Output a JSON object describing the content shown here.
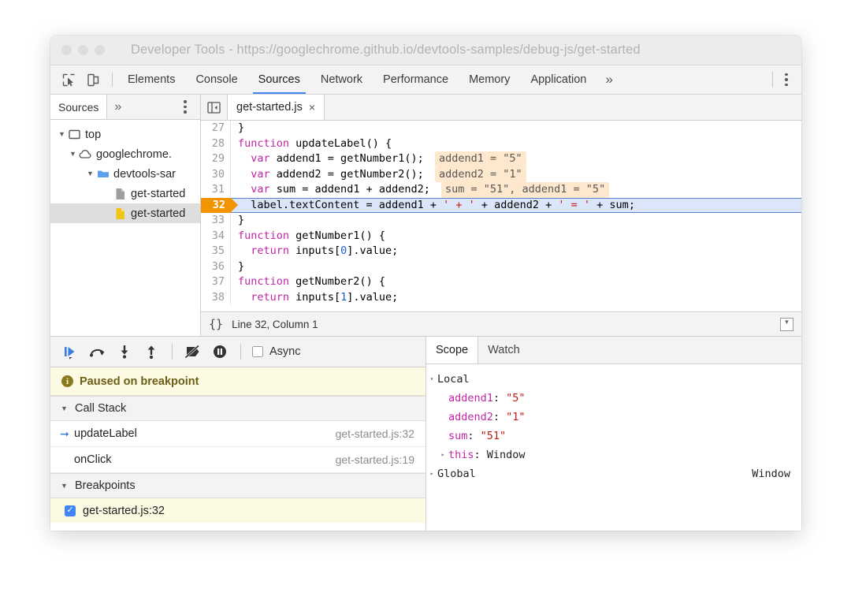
{
  "window": {
    "title": "Developer Tools - https://googlechrome.github.io/devtools-samples/debug-js/get-started",
    "traffic_lights": [
      "close",
      "minimize",
      "zoom"
    ]
  },
  "toolbar": {
    "inspect_icon": "inspect-element-icon",
    "device_icon": "device-toolbar-icon",
    "overflow_label": "»",
    "kebab_label": "more-options",
    "tabs": [
      {
        "label": "Elements",
        "active": false
      },
      {
        "label": "Console",
        "active": false
      },
      {
        "label": "Sources",
        "active": true
      },
      {
        "label": "Network",
        "active": false
      },
      {
        "label": "Performance",
        "active": false
      },
      {
        "label": "Memory",
        "active": false
      },
      {
        "label": "Application",
        "active": false
      }
    ]
  },
  "navigator": {
    "tab_label": "Sources",
    "overflow_label": "»",
    "tree": [
      {
        "label": "top",
        "icon": "frame-icon",
        "triangle": "▼",
        "indent": 0,
        "selected": false
      },
      {
        "label": "googlechrome.",
        "icon": "cloud-icon",
        "triangle": "▼",
        "indent": 1,
        "selected": false
      },
      {
        "label": "devtools-sar",
        "icon": "folder-icon",
        "triangle": "▼",
        "indent": 2,
        "selected": false
      },
      {
        "label": "get-started",
        "icon": "document-icon",
        "triangle": "",
        "indent": 3,
        "selected": false
      },
      {
        "label": "get-started",
        "icon": "script-icon",
        "triangle": "",
        "indent": 3,
        "selected": true
      }
    ]
  },
  "editor": {
    "panel_toggle_icon": "show-navigator-icon",
    "tab_label": "get-started.js",
    "tab_close": "×",
    "status": {
      "format_icon": "{}",
      "position": "Line 32, Column 1",
      "popout_icon": "▼"
    },
    "lines": [
      {
        "n": "27",
        "current": false,
        "code": "}",
        "inline": null
      },
      {
        "n": "28",
        "current": false,
        "code": "function updateLabel() {",
        "inline": null
      },
      {
        "n": "29",
        "current": false,
        "code": "  var addend1 = getNumber1();",
        "inline": "addend1 = \"5\""
      },
      {
        "n": "30",
        "current": false,
        "code": "  var addend2 = getNumber2();",
        "inline": "addend2 = \"1\""
      },
      {
        "n": "31",
        "current": false,
        "code": "  var sum = addend1 + addend2;",
        "inline": "sum = \"51\", addend1 = \"5\""
      },
      {
        "n": "32",
        "current": true,
        "code": "  label.textContent = addend1 + ' + ' + addend2 + ' = ' + sum;",
        "inline": null
      },
      {
        "n": "33",
        "current": false,
        "code": "}",
        "inline": null
      },
      {
        "n": "34",
        "current": false,
        "code": "function getNumber1() {",
        "inline": null
      },
      {
        "n": "35",
        "current": false,
        "code": "  return inputs[0].value;",
        "inline": null
      },
      {
        "n": "36",
        "current": false,
        "code": "}",
        "inline": null
      },
      {
        "n": "37",
        "current": false,
        "code": "function getNumber2() {",
        "inline": null
      },
      {
        "n": "38",
        "current": false,
        "code": "  return inputs[1].value;",
        "inline": null
      }
    ]
  },
  "debugger": {
    "controls": [
      {
        "name": "resume-script-execution",
        "glyph": "resume"
      },
      {
        "name": "step-over-next-function-call",
        "glyph": "step-over"
      },
      {
        "name": "step-into-next-function-call",
        "glyph": "step-into"
      },
      {
        "name": "step-out-of-current-function",
        "glyph": "step-out"
      },
      {
        "name": "deactivate-breakpoints",
        "glyph": "deactivate"
      },
      {
        "name": "pause-on-exceptions",
        "glyph": "pause-exceptions"
      }
    ],
    "async_label": "Async",
    "async_checked": false,
    "paused_message": "Paused on breakpoint",
    "call_stack": {
      "title": "Call Stack",
      "triangle": "▼",
      "frames": [
        {
          "name": "updateLabel",
          "location": "get-started.js:32",
          "selected": true
        },
        {
          "name": "onClick",
          "location": "get-started.js:19",
          "selected": false
        }
      ]
    },
    "breakpoints": {
      "title": "Breakpoints",
      "triangle": "▼",
      "items": [
        {
          "label": "get-started.js:32",
          "checked": true
        }
      ]
    }
  },
  "scope": {
    "tabs": [
      {
        "label": "Scope",
        "active": true
      },
      {
        "label": "Watch",
        "active": false
      }
    ],
    "rows": [
      {
        "indent": 0,
        "triangle": "▾",
        "name": "Local",
        "sep": "",
        "value": "",
        "value_kind": "plain",
        "right": ""
      },
      {
        "indent": 1,
        "triangle": "",
        "name": "addend1",
        "sep": ": ",
        "value": "\"5\"",
        "value_kind": "string",
        "right": ""
      },
      {
        "indent": 1,
        "triangle": "",
        "name": "addend2",
        "sep": ": ",
        "value": "\"1\"",
        "value_kind": "string",
        "right": ""
      },
      {
        "indent": 1,
        "triangle": "",
        "name": "sum",
        "sep": ": ",
        "value": "\"51\"",
        "value_kind": "string",
        "right": ""
      },
      {
        "indent": 1,
        "triangle": "▸",
        "name": "this",
        "sep": ": ",
        "value": "Window",
        "value_kind": "plain",
        "right": ""
      },
      {
        "indent": 0,
        "triangle": "▸",
        "name": "Global",
        "sep": "",
        "value": "",
        "value_kind": "plain",
        "right": "Window"
      }
    ]
  },
  "colors": {
    "accent": "#4285f4",
    "breakpoint_marker": "#f29300",
    "current_line": "#dce6fa",
    "paused_banner": "#fdfae3",
    "inline_value_bg": "#fde8cd",
    "keyword": "#c026a5",
    "string": "#c41a16",
    "number": "#1c5fd8"
  }
}
